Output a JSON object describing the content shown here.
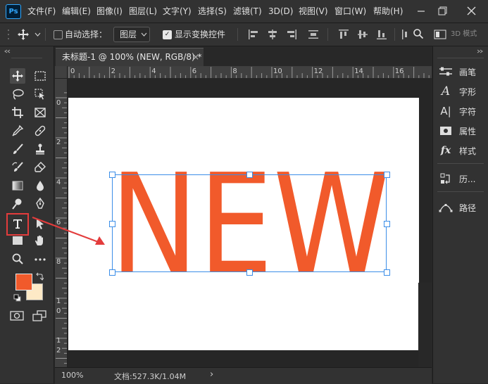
{
  "app": {
    "logo": "Ps"
  },
  "menu": [
    "文件(F)",
    "编辑(E)",
    "图像(I)",
    "图层(L)",
    "文字(Y)",
    "选择(S)",
    "滤镜(T)",
    "3D(D)",
    "视图(V)",
    "窗口(W)",
    "帮助(H)"
  ],
  "options": {
    "auto_select_label": "自动选择：",
    "auto_select_checked": false,
    "layer_value": "图层",
    "show_transform_label": "显示变换控件",
    "show_transform_checked": true,
    "mode_3d_label": "3D 模式"
  },
  "document": {
    "tab_title": "未标题-1 @ 100% (NEW, RGB/8) *",
    "close_glyph": "×",
    "canvas_text": "NEW",
    "text_color": "#f15a2b",
    "ruler_top_labels": [
      "0",
      "2",
      "4",
      "6",
      "8",
      "10",
      "12",
      "14",
      "16"
    ],
    "ruler_left_labels": [
      "0",
      "2",
      "4",
      "6",
      "8",
      "1",
      "0",
      "1",
      "2"
    ]
  },
  "status": {
    "zoom": "100%",
    "doc_info": "文档:527.3K/1.04M",
    "arrow": "›"
  },
  "colors": {
    "foreground": "#f15a2b",
    "background": "#fde9c6",
    "highlight": "#e33c3c"
  },
  "tools": [
    "move-icon",
    "marquee-icon",
    "lasso-icon",
    "object-select-icon",
    "crop-icon",
    "frame-icon",
    "eyedropper-icon",
    "healing-icon",
    "brush-icon",
    "stamp-icon",
    "history-brush-icon",
    "eraser-icon",
    "gradient-icon",
    "blur-icon",
    "dodge-icon",
    "pen-icon",
    "type-icon",
    "path-select-icon",
    "rectangle-icon",
    "hand-icon",
    "zoom-icon",
    "more-icon"
  ],
  "panels": [
    {
      "label": "画笔",
      "icon": "brush-settings-icon"
    },
    {
      "label": "字形",
      "icon": "glyphs-icon"
    },
    {
      "label": "字符",
      "icon": "character-icon"
    },
    {
      "label": "属性",
      "icon": "properties-icon"
    },
    {
      "label": "样式",
      "icon": "styles-icon"
    },
    {
      "label": "历...",
      "icon": "history-icon"
    },
    {
      "label": "路径",
      "icon": "paths-icon"
    }
  ]
}
